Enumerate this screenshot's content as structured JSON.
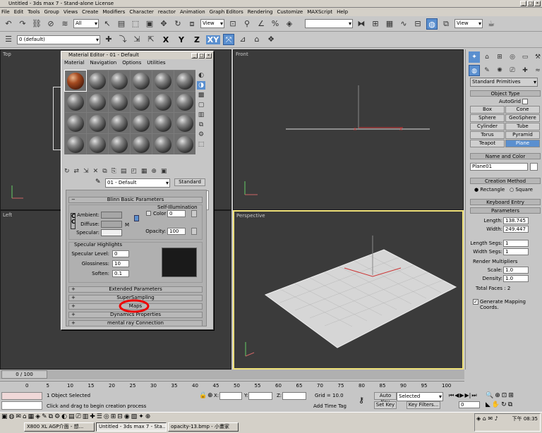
{
  "window": {
    "title": "Untitled - 3ds max 7 - Stand-alone License"
  },
  "menu": [
    "File",
    "Edit",
    "Tools",
    "Group",
    "Views",
    "Create",
    "Modifiers",
    "Character",
    "reactor",
    "Animation",
    "Graph Editors",
    "Rendering",
    "Customize",
    "MAXScript",
    "Help"
  ],
  "toolbar": {
    "selection_filter": "All",
    "ref_coord": "View",
    "view_combo2": "View",
    "layer": "0 (default)",
    "axis_x": "X",
    "axis_y": "Y",
    "axis_z": "Z",
    "axis_xy": "XY"
  },
  "viewports": {
    "top": "Top",
    "front": "Front",
    "left": "Left",
    "perspective": "Perspective"
  },
  "material_editor": {
    "title": "Material Editor - 01 - Default",
    "menu": [
      "Material",
      "Navigation",
      "Options",
      "Utilities"
    ],
    "material_name": "01 - Default",
    "material_type": "Standard",
    "blinn_header": "Blinn Basic Parameters",
    "self_illum": "Self-Illumination",
    "ambient": "Ambient:",
    "diffuse": "Diffuse:",
    "specular": "Specular:",
    "color_label": "Color",
    "color_value": "0",
    "m_label": "M",
    "opacity_label": "Opacity:",
    "opacity_value": "100",
    "spec_highlights": "Specular Highlights",
    "spec_level_label": "Specular Level:",
    "spec_level": "0",
    "glossiness_label": "Glossiness:",
    "glossiness": "10",
    "soften_label": "Soften:",
    "soften": "0.1",
    "rollouts": [
      "Extended Parameters",
      "SuperSampling",
      "Maps",
      "Dynamics Properties",
      "mental ray Connection"
    ]
  },
  "command_panel": {
    "dropdown": "Standard Primitives",
    "object_type": "Object Type",
    "autogrid": "AutoGrid",
    "buttons": [
      "Box",
      "Cone",
      "Sphere",
      "GeoSphere",
      "Cylinder",
      "Tube",
      "Torus",
      "Pyramid",
      "Teapot",
      "Plane"
    ],
    "name_color": "Name and Color",
    "object_name": "Plane01",
    "creation_method": "Creation Method",
    "rectangle": "Rectangle",
    "square": "Square",
    "keyboard_entry": "Keyboard Entry",
    "parameters": "Parameters",
    "length_label": "Length:",
    "length": "138.745",
    "width_label": "Width:",
    "width": "249.447",
    "length_segs_label": "Length Segs:",
    "length_segs": "1",
    "width_segs_label": "Width Segs:",
    "width_segs": "1",
    "render_mult": "Render Multipliers",
    "scale_label": "Scale:",
    "scale": "1.0",
    "density_label": "Density:",
    "density": "1.0",
    "total_faces": "Total Faces : 2",
    "gen_map": "Generate Mapping Coords."
  },
  "timeline": {
    "slider": "0 / 100",
    "ticks": [
      "0",
      "5",
      "10",
      "15",
      "20",
      "25",
      "30",
      "35",
      "40",
      "45",
      "50",
      "55",
      "60",
      "65",
      "70",
      "75",
      "80",
      "85",
      "90",
      "95",
      "100"
    ]
  },
  "status": {
    "selected": "1 Object Selected",
    "prompt": "Click and drag to begin creation process",
    "x_label": "X:",
    "y_label": "Y:",
    "z_label": "Z:",
    "grid": "Grid = 10.0",
    "add_time_tag": "Add Time Tag",
    "auto_key": "Auto Key",
    "selected_combo": "Selected",
    "set_key": "Set Key",
    "key_filters": "Key Filters...",
    "frame": "0"
  },
  "taskbar": {
    "clock": "下午 08:35",
    "tasks": [
      "X800 XL AGP介面 - 想...",
      "Untitled - 3ds max 7 - Sta...",
      "opacity-13.bmp - 小畫家"
    ]
  }
}
